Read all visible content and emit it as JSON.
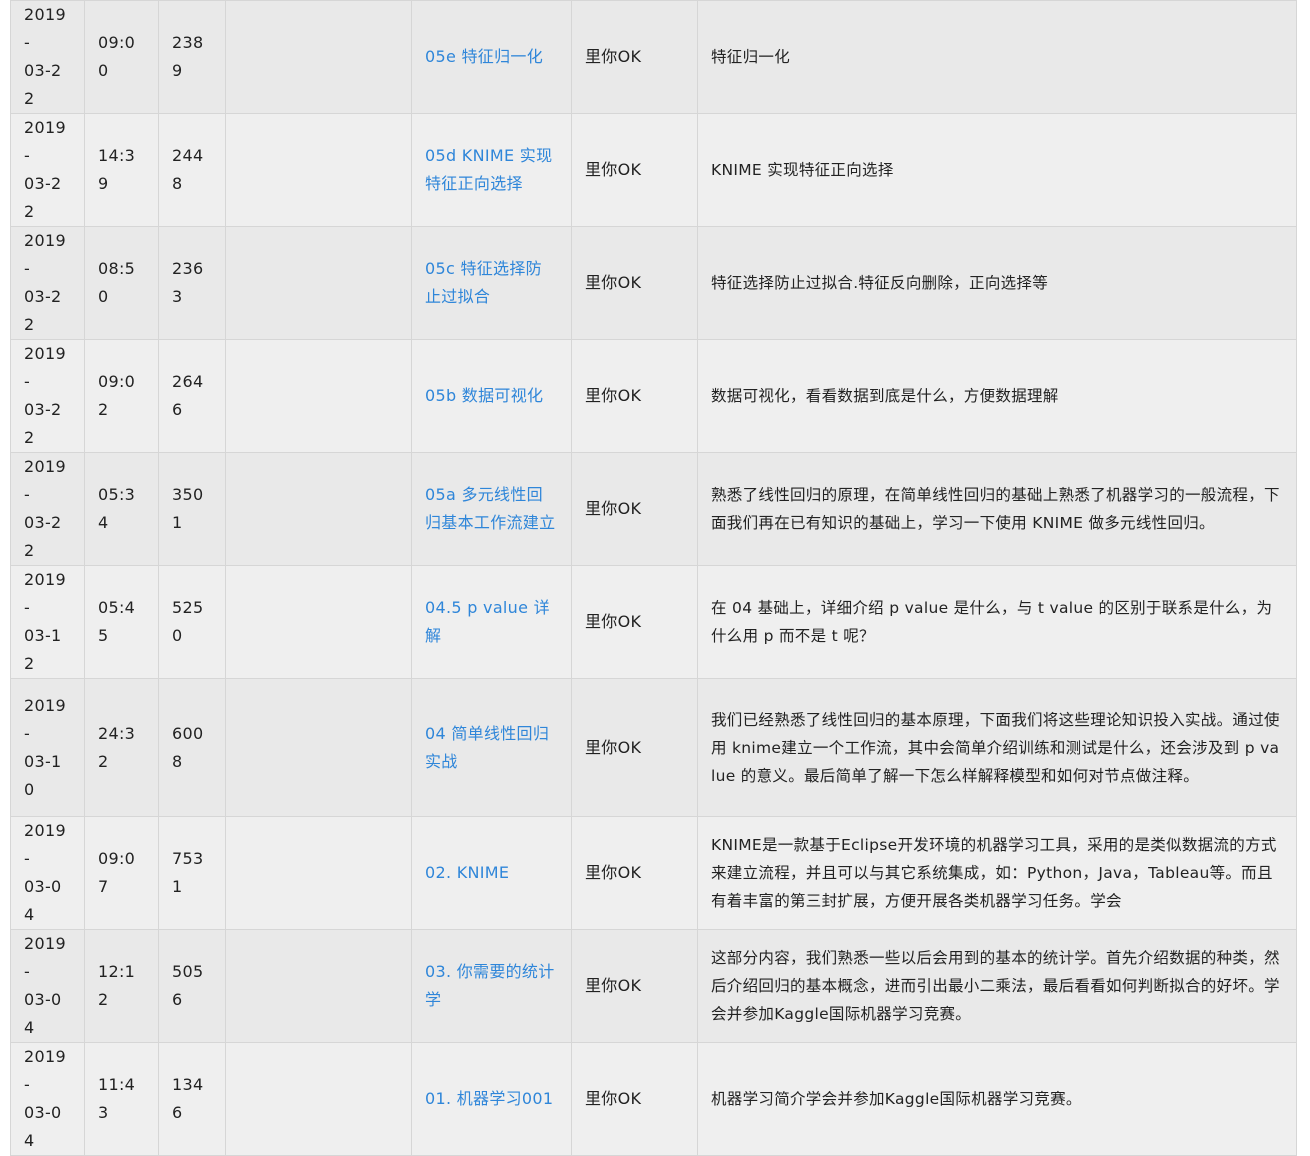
{
  "table": {
    "rows": [
      {
        "date_year": "2019-",
        "date_md": "03-22",
        "time": "09:00",
        "views": "2389",
        "title": "05e 特征归一化",
        "author": "里你OK",
        "desc": "特征归一化"
      },
      {
        "date_year": "2019-",
        "date_md": "03-22",
        "time": "14:39",
        "views": "2448",
        "title": "05d KNIME 实现特征正向选择",
        "author": "里你OK",
        "desc": "KNIME 实现特征正向选择"
      },
      {
        "date_year": "2019-",
        "date_md": "03-22",
        "time": "08:50",
        "views": "2363",
        "title": "05c 特征选择防止过拟合",
        "author": "里你OK",
        "desc": "特征选择防止过拟合.特征反向删除，正向选择等"
      },
      {
        "date_year": "2019-",
        "date_md": "03-22",
        "time": "09:02",
        "views": "2646",
        "title": "05b 数据可视化",
        "author": "里你OK",
        "desc": "数据可视化，看看数据到底是什么，方便数据理解"
      },
      {
        "date_year": "2019-",
        "date_md": "03-22",
        "time": "05:34",
        "views": "3501",
        "title": "05a 多元线性回归基本工作流建立",
        "author": "里你OK",
        "desc": "熟悉了线性回归的原理，在简单线性回归的基础上熟悉了机器学习的一般流程，下面我们再在已有知识的基础上，学习一下使用 KNIME 做多元线性回归。"
      },
      {
        "date_year": "2019-",
        "date_md": "03-12",
        "time": "05:45",
        "views": "5250",
        "title": "04.5 p value 详解",
        "author": "里你OK",
        "desc": "在 04 基础上，详细介绍 p value 是什么，与 t value 的区别于联系是什么，为什么用 p 而不是 t 呢？"
      },
      {
        "date_year": "2019-",
        "date_md": "03-10",
        "time": "24:32",
        "views": "6008",
        "title": "04 简单线性回归实战",
        "author": "里你OK",
        "desc": "我们已经熟悉了线性回归的基本原理，下面我们将这些理论知识投入实战。通过使用 knime建立一个工作流，其中会简单介绍训练和测试是什么，还会涉及到 p value 的意义。最后简单了解一下怎么样解释模型和如何对节点做注释。"
      },
      {
        "date_year": "2019-",
        "date_md": "03-04",
        "time": "09:07",
        "views": "7531",
        "title": "02. KNIME",
        "author": "里你OK",
        "desc": "KNIME是一款基于Eclipse开发环境的机器学习工具，采用的是类似数据流的方式来建立流程，并且可以与其它系统集成，如：Python，Java，Tableau等。而且有着丰富的第三封扩展，方便开展各类机器学习任务。学会"
      },
      {
        "date_year": "2019-",
        "date_md": "03-04",
        "time": "12:12",
        "views": "5056",
        "title": "03. 你需要的统计学",
        "author": "里你OK",
        "desc": "这部分内容，我们熟悉一些以后会用到的基本的统计学。首先介绍数据的种类，然后介绍回归的基本概念，进而引出最小二乘法，最后看看如何判断拟合的好坏。学会并参加Kaggle国际机器学习竞赛。"
      },
      {
        "date_year": "2019-",
        "date_md": "03-04",
        "time": "11:43",
        "views": "1346",
        "title": "01. 机器学习001",
        "author": "里你OK",
        "desc": "机器学习简介学会并参加Kaggle国际机器学习竞赛。"
      }
    ]
  }
}
